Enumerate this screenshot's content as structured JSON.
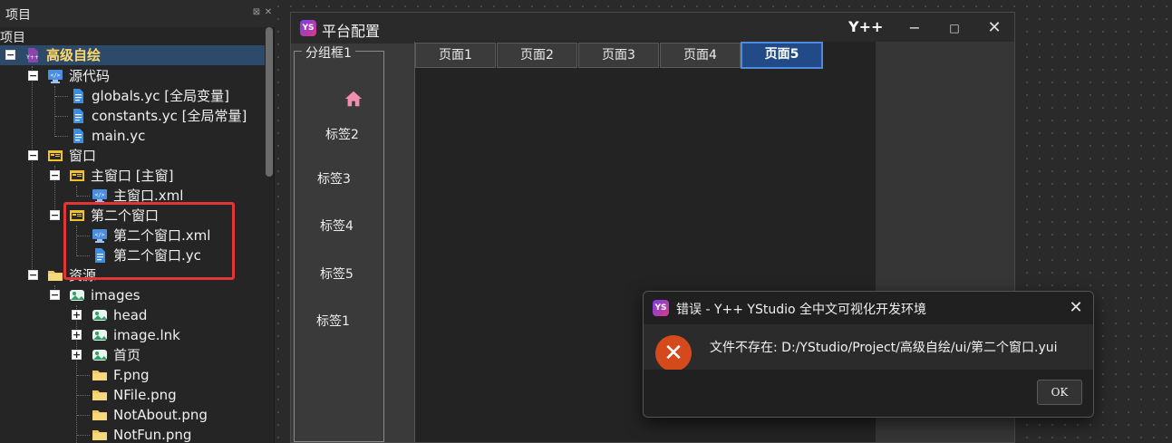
{
  "project_panel": {
    "title": "项目",
    "pin_glyph": "⊠",
    "close_glyph": "✕",
    "tree_caption": "项目"
  },
  "tree": [
    {
      "label": "高级自绘",
      "icon": "project-icon",
      "toggle": "−",
      "selected": true
    },
    {
      "label": "源代码",
      "icon": "code-folder-icon",
      "toggle": "−"
    },
    {
      "label": "globals.yc [全局变量]",
      "icon": "file-icon"
    },
    {
      "label": "constants.yc [全局常量]",
      "icon": "file-icon"
    },
    {
      "label": "main.yc",
      "icon": "file-icon"
    },
    {
      "label": "窗口",
      "icon": "window-folder-icon",
      "toggle": "−"
    },
    {
      "label": "主窗口 [主窗]",
      "icon": "window-icon",
      "toggle": "−"
    },
    {
      "label": "主窗口.xml",
      "icon": "xml-file-icon"
    },
    {
      "label": "第二个窗口",
      "icon": "window-icon",
      "toggle": "−"
    },
    {
      "label": "第二个窗口.xml",
      "icon": "xml-file-icon"
    },
    {
      "label": "第二个窗口.yc",
      "icon": "file-icon"
    },
    {
      "label": "资源",
      "icon": "folder-icon",
      "toggle": "−"
    },
    {
      "label": "images",
      "icon": "image-folder-icon",
      "toggle": "−"
    },
    {
      "label": "head",
      "icon": "image-folder-icon",
      "toggle": "+"
    },
    {
      "label": "image.lnk",
      "icon": "image-folder-icon",
      "toggle": "+"
    },
    {
      "label": "首页",
      "icon": "image-folder-icon",
      "toggle": "+"
    },
    {
      "label": "F.png",
      "icon": "folder-icon"
    },
    {
      "label": "NFile.png",
      "icon": "folder-icon"
    },
    {
      "label": "NotAbout.png",
      "icon": "folder-icon"
    },
    {
      "label": "NotFun.png",
      "icon": "folder-icon"
    }
  ],
  "designer": {
    "logo_text": "YS",
    "title": "平台配置",
    "brand": "Y++",
    "minimize_glyph": "−",
    "maximize_glyph": "□",
    "close_glyph": "✕",
    "group_label": "分组框1",
    "side_items": [
      "标签2",
      "标签3",
      "标签4",
      "标签5",
      "标签1"
    ],
    "tabs": [
      "页面1",
      "页面2",
      "页面3",
      "页面4",
      "页面5"
    ],
    "active_tab": "页面5"
  },
  "dialog": {
    "logo_text": "YS",
    "title": "错误 - Y++ YStudio 全中文可视化开发环境",
    "close_glyph": "✕",
    "error_glyph": "✕",
    "message": "文件不存在: D:/YStudio/Project/高级自绘/ui/第二个窗口.yui",
    "ok_label": "OK"
  },
  "colors": {
    "highlight_border": "#e33535",
    "active_tab_bg": "#214a86",
    "error_icon": "#d44a1c"
  }
}
